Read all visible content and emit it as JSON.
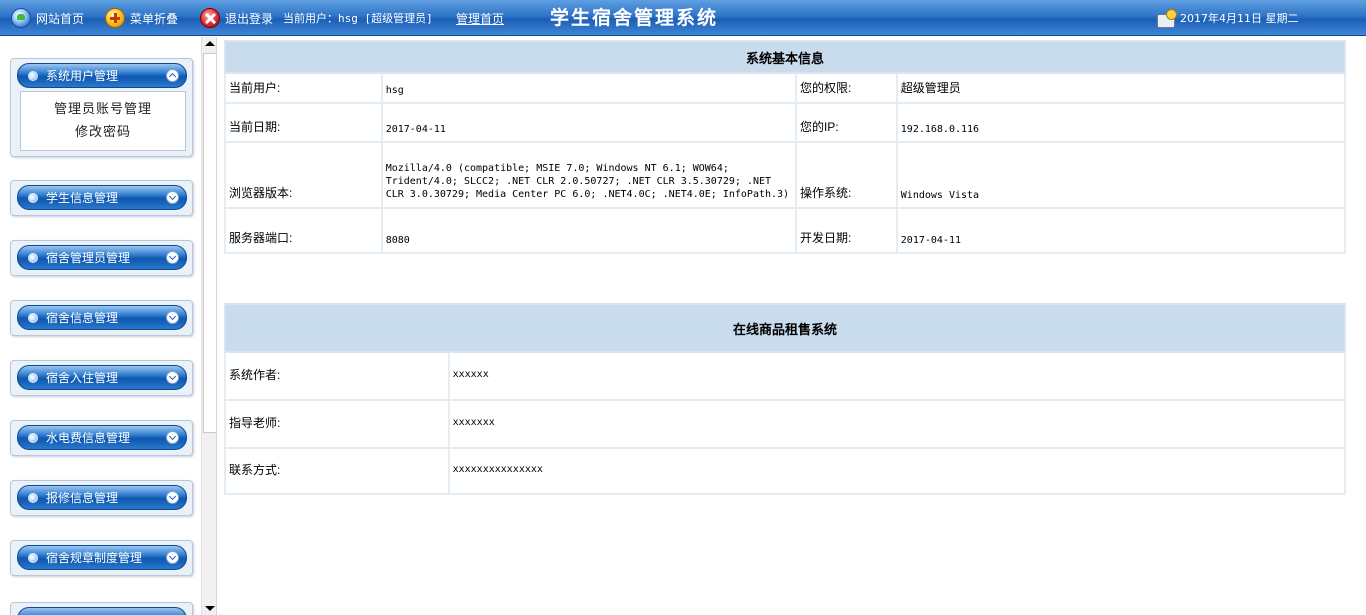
{
  "topbar": {
    "site_home": "网站首页",
    "menu_fold": "菜单折叠",
    "logout": "退出登录",
    "current_user": "当前用户：hsg [超级管理员]",
    "admin_home": "管理首页",
    "app_title": "学生宿舍管理系统",
    "date": "2017年4月11日 星期二"
  },
  "sidebar": {
    "groups": [
      {
        "label": "系统用户管理",
        "expanded": true,
        "items": [
          "管理员账号管理",
          "修改密码"
        ]
      },
      {
        "label": "学生信息管理",
        "expanded": false
      },
      {
        "label": "宿舍管理员管理",
        "expanded": false
      },
      {
        "label": "宿舍信息管理",
        "expanded": false
      },
      {
        "label": "宿舍入住管理",
        "expanded": false
      },
      {
        "label": "水电费信息管理",
        "expanded": false
      },
      {
        "label": "报修信息管理",
        "expanded": false
      },
      {
        "label": "宿舍规章制度管理",
        "expanded": false
      }
    ]
  },
  "basic_info": {
    "title": "系统基本信息",
    "current_user_label": "当前用户:",
    "current_user": "hsg",
    "permission_label": "您的权限:",
    "permission": "超级管理员",
    "current_date_label": "当前日期:",
    "current_date": "2017-04-11",
    "ip_label": "您的IP:",
    "ip": "192.168.0.116",
    "browser_label": "浏览器版本:",
    "browser": "Mozilla/4.0 (compatible; MSIE 7.0; Windows NT 6.1; WOW64; Trident/4.0; SLCC2; .NET CLR 2.0.50727; .NET CLR 3.5.30729; .NET CLR 3.0.30729; Media Center PC 6.0; .NET4.0C; .NET4.0E; InfoPath.3)",
    "os_label": "操作系统:",
    "os": "Windows Vista",
    "port_label": "服务器端口:",
    "port": "8080",
    "dev_date_label": "开发日期:",
    "dev_date": "2017-04-11"
  },
  "project_info": {
    "title": "在线商品租售系统",
    "author_label": "系统作者:",
    "author": "xxxxxx",
    "teacher_label": "指导老师:",
    "teacher": "xxxxxxx",
    "contact_label": "联系方式:",
    "contact": "xxxxxxxxxxxxxxx"
  },
  "colors": {
    "topbar_blue": "#2f74c8",
    "header_cell": "#c8dcee",
    "menu_head": "#0e57b0"
  }
}
